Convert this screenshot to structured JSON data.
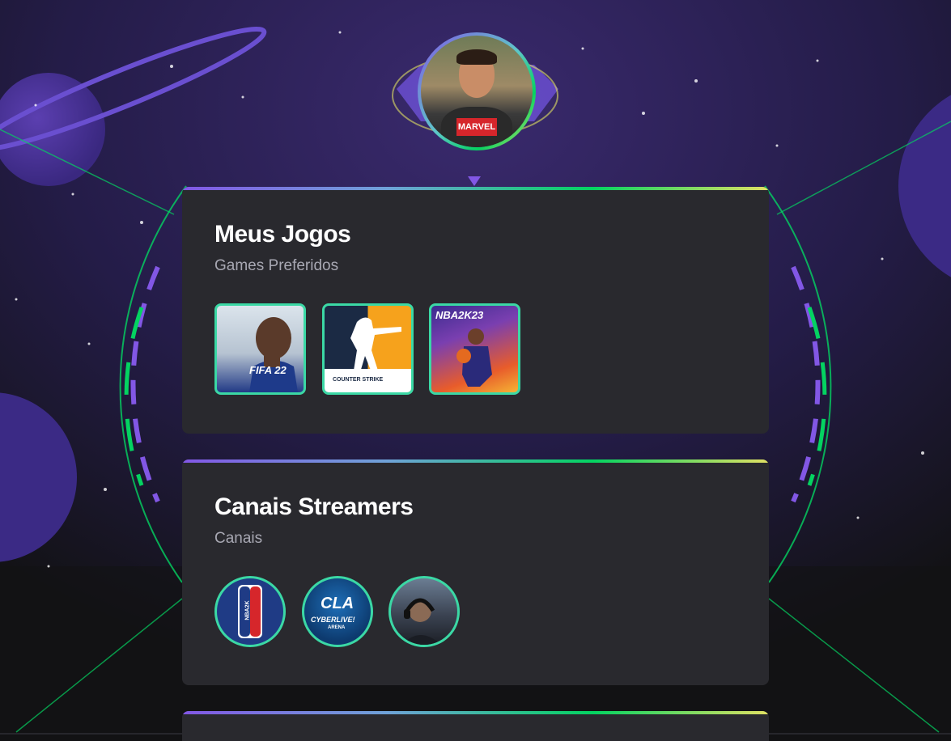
{
  "profile": {
    "avatar_shirt_text": "MARVEL"
  },
  "cards": {
    "games": {
      "title": "Meus Jogos",
      "subtitle": "Games Preferidos",
      "items": [
        {
          "name": "FIFA 22",
          "label": "FIFA 22"
        },
        {
          "name": "Counter Strike",
          "label": "COUNTER STRIKE"
        },
        {
          "name": "NBA 2K23",
          "label": "NBA2K23"
        }
      ]
    },
    "channels": {
      "title": "Canais Streamers",
      "subtitle": "Canais",
      "items": [
        {
          "name": "NBA 2K League",
          "label": "NBA2K"
        },
        {
          "name": "CLA CyberLive Arena",
          "label": "CLA",
          "sub": "CYBERLIVE!",
          "sub2": "ARENA"
        },
        {
          "name": "Streamer channel",
          "label": ""
        }
      ]
    }
  },
  "colors": {
    "accent_purple": "#8257e5",
    "accent_green": "#04d361",
    "accent_yellow": "#e1e163",
    "card_bg": "#29292e",
    "page_bg": "#121214"
  }
}
